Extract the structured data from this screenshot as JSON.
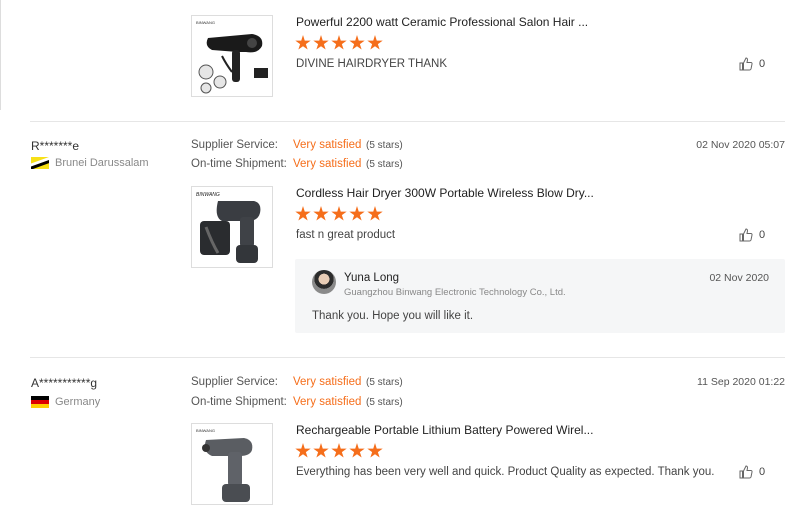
{
  "reviews": [
    {
      "product": {
        "title": "Powerful 2200 watt Ceramic Professional Salon Hair ...",
        "brand_mark": "BINWANG",
        "rating": 5
      },
      "text": "DIVINE HAIRDRYER THANK",
      "likes": "0"
    },
    {
      "reviewer": "R*******e",
      "country": "Brunei Darussalam",
      "supplier_service": {
        "label": "Supplier Service:",
        "value": "Very satisfied",
        "stars": "(5 stars)"
      },
      "ontime_shipment": {
        "label": "On-time Shipment:",
        "value": "Very satisfied",
        "stars": "(5 stars)"
      },
      "date": "02 Nov 2020 05:07",
      "product": {
        "title": "Cordless Hair Dryer 300W Portable Wireless Blow Dry...",
        "brand_mark": "BINWANG",
        "rating": 5
      },
      "text": "fast n great product",
      "likes": "0",
      "reply": {
        "name": "Yuna Long",
        "company": "Guangzhou Binwang Electronic Technology Co., Ltd.",
        "date": "02 Nov 2020",
        "text": "Thank you. Hope you will like it."
      }
    },
    {
      "reviewer": "A***********g",
      "country": "Germany",
      "supplier_service": {
        "label": "Supplier Service:",
        "value": "Very satisfied",
        "stars": "(5 stars)"
      },
      "ontime_shipment": {
        "label": "On-time Shipment:",
        "value": "Very satisfied",
        "stars": "(5 stars)"
      },
      "date": "11 Sep 2020 01:22",
      "product": {
        "title": "Rechargeable Portable Lithium Battery Powered Wirel...",
        "brand_mark": "BINWANG",
        "rating": 5
      },
      "text": "Everything has been very well and quick. Product Quality as expected. Thank you.",
      "likes": "0"
    }
  ],
  "colors": {
    "accent": "#f56e1b",
    "divider": "#e6e6e6",
    "reply_bg": "#f5f6f7"
  },
  "icons": {
    "like": "thumbs-up-icon",
    "star": "star-icon"
  }
}
